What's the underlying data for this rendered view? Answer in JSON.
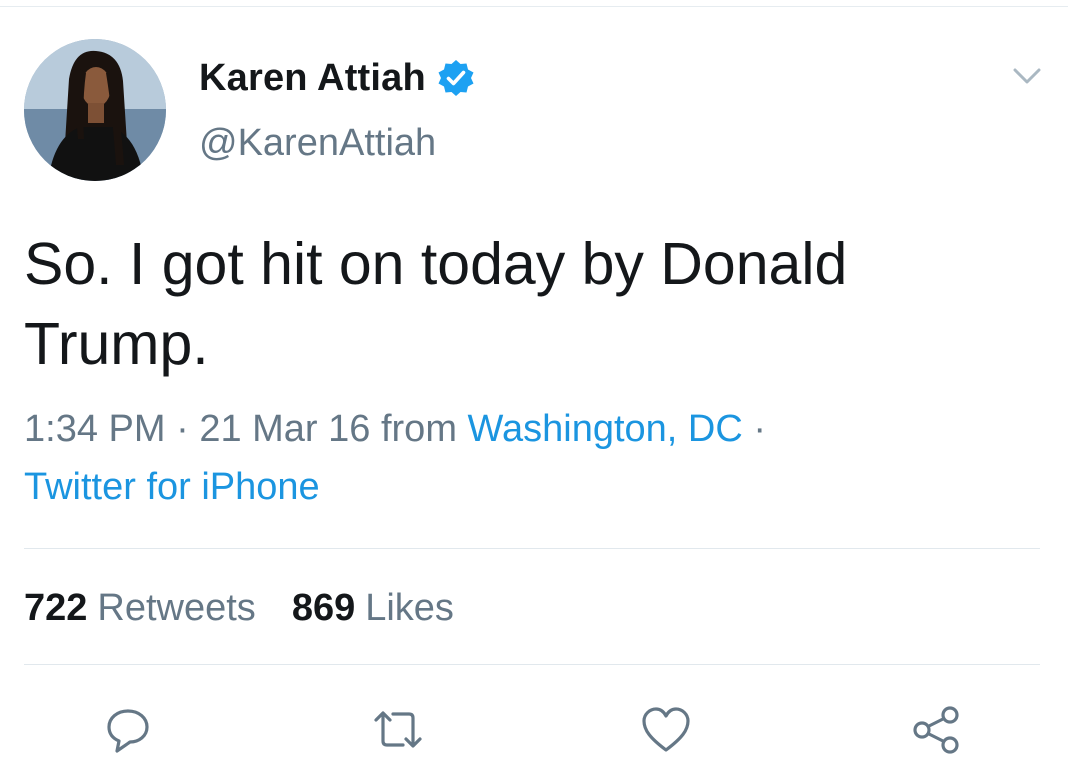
{
  "author": {
    "display_name": "Karen Attiah",
    "handle": "@KarenAttiah",
    "verified": true
  },
  "tweet": {
    "text": "So. I got hit on today by Donald Trump.",
    "time": "1:34 PM",
    "date": "21 Mar 16",
    "from_word": "from",
    "location": "Washington, DC",
    "source": "Twitter for iPhone",
    "separator": "·"
  },
  "stats": {
    "retweets_count": "722",
    "retweets_label": "Retweets",
    "likes_count": "869",
    "likes_label": "Likes"
  },
  "icons": {
    "menu": "chevron-down-icon",
    "verified": "verified-badge-icon",
    "reply": "reply-icon",
    "retweet": "retweet-icon",
    "like": "heart-icon",
    "share": "share-icon"
  },
  "colors": {
    "link": "#1b95e0",
    "secondary_text": "#657786",
    "primary_text": "#14171a",
    "verified": "#1da1f2",
    "divider": "#e1e8ed"
  }
}
